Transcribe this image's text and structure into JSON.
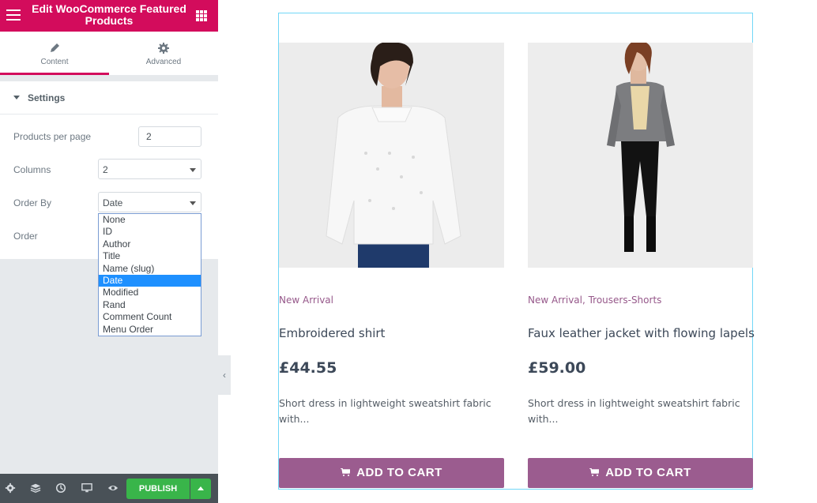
{
  "panel": {
    "title": "Edit WooCommerce Featured Products",
    "tabs": [
      {
        "label": "Content",
        "icon": "pencil-icon",
        "active": true
      },
      {
        "label": "Advanced",
        "icon": "gear-icon",
        "active": false
      }
    ],
    "section_title": "Settings",
    "controls": {
      "products_per_page": {
        "label": "Products per page",
        "value": "2"
      },
      "columns": {
        "label": "Columns",
        "value": "2"
      },
      "order_by": {
        "label": "Order By",
        "value": "Date"
      },
      "order": {
        "label": "Order"
      }
    },
    "order_by_options": [
      "None",
      "ID",
      "Author",
      "Title",
      "Name (slug)",
      "Date",
      "Modified",
      "Rand",
      "Comment Count",
      "Menu Order"
    ],
    "order_by_selected": "Date",
    "footer": {
      "publish_label": "PUBLISH"
    },
    "colors": {
      "brand": "#d30c5c",
      "publish": "#39b54a",
      "footer": "#495157"
    }
  },
  "products": [
    {
      "categories": "New Arrival",
      "name": "Embroidered shirt",
      "price": "£44.55",
      "description": "Short dress in lightweight sweatshirt fabric with...",
      "button": "ADD TO CART"
    },
    {
      "categories": "New Arrival, Trousers-Shorts",
      "name": "Faux leather jacket with flowing lapels",
      "price": "£59.00",
      "description": "Short dress in lightweight sweatshirt fabric with...",
      "button": "ADD TO CART"
    }
  ],
  "colors": {
    "accent": "#96588a",
    "button": "#9b5c8f",
    "frame": "#71d7f7"
  }
}
